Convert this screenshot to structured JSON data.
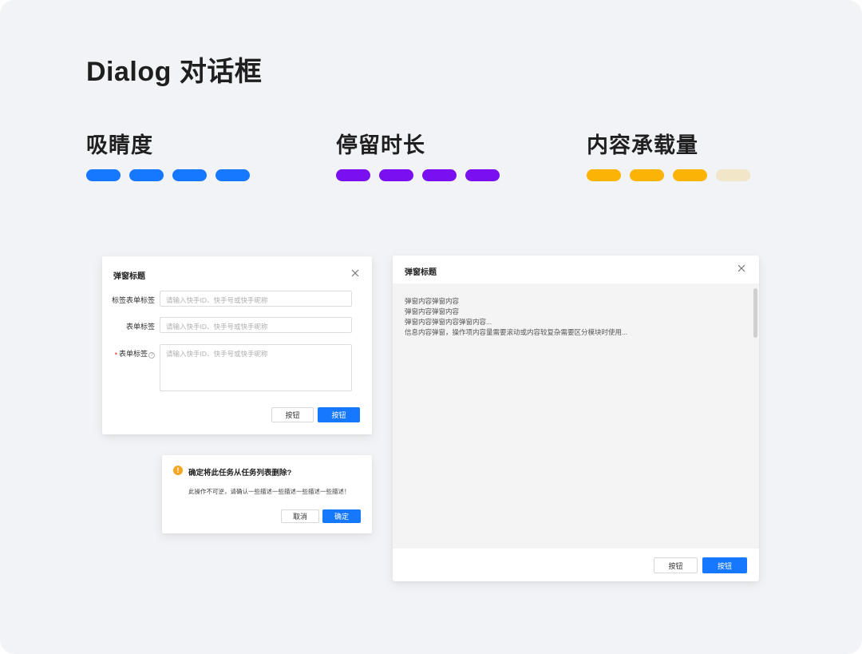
{
  "page": {
    "title": "Dialog 对话框"
  },
  "metrics": [
    {
      "label": "吸睛度",
      "level": 4,
      "max": 4,
      "color": "#1677ff",
      "inactive_color": "#f1e6c8"
    },
    {
      "label": "停留时长",
      "level": 4,
      "max": 4,
      "color": "#7a10f0",
      "inactive_color": "#f1e6c8"
    },
    {
      "label": "内容承载量",
      "level": 3,
      "max": 4,
      "color": "#fbb406",
      "inactive_color": "#f2e6c9"
    }
  ],
  "form_dialog": {
    "title": "弹窗标题",
    "close_icon": "close-icon",
    "fields": [
      {
        "label": "标签表单标签",
        "placeholder": "请输入快手ID、快手号或快手昵称",
        "required": false,
        "help": false
      },
      {
        "label": "表单标签",
        "placeholder": "请输入快手ID、快手号或快手昵称",
        "required": false,
        "help": false
      },
      {
        "label": "表单标签",
        "placeholder": "请输入快手ID、快手号或快手昵称",
        "required": true,
        "help": true,
        "help_glyph": "?"
      }
    ],
    "required_mark": "•",
    "secondary_button": "按钮",
    "primary_button": "按钮"
  },
  "confirm_dialog": {
    "icon": "warning-icon",
    "icon_glyph": "!",
    "title": "确定将此任务从任务列表删除?",
    "description": "此操作不可逆，请确认一些描述一些描述一些描述一些描述！",
    "cancel_button": "取消",
    "confirm_button": "确定"
  },
  "large_dialog": {
    "title": "弹窗标题",
    "close_icon": "close-icon",
    "body_lines": [
      "弹窗内容弹窗内容",
      "弹窗内容弹窗内容",
      "弹窗内容弹窗内容弹窗内容...",
      "信息内容弹窗，操作项内容量需要滚动或内容较复杂需要区分模块时使用..."
    ],
    "secondary_button": "按钮",
    "primary_button": "按钮"
  },
  "colors": {
    "canvas": "#f2f3f6",
    "primary": "#1677ff",
    "warning": "#f5a623",
    "required": "#ff4d4f"
  }
}
